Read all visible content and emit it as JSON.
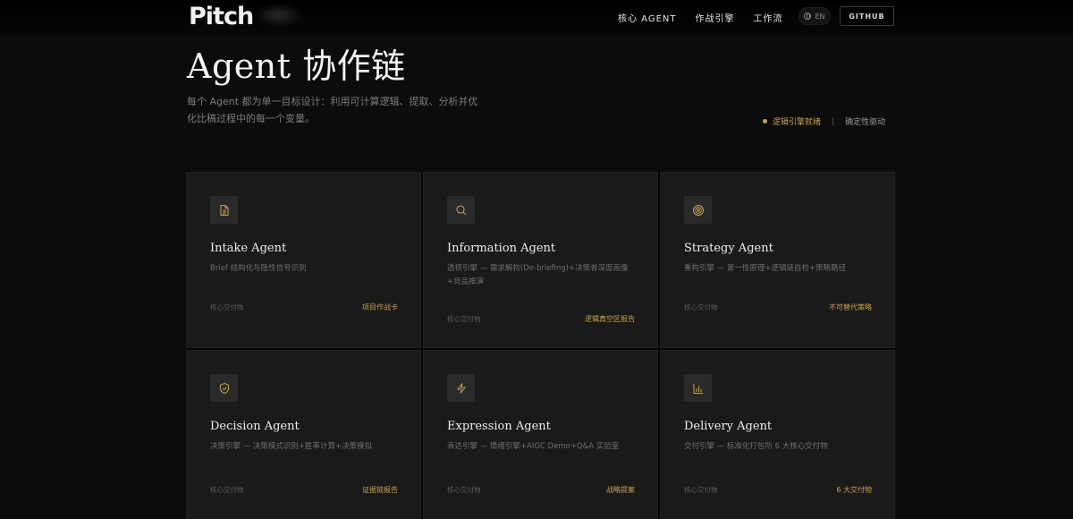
{
  "nav": {
    "logo": "Pitch",
    "links": [
      "核心 AGENT",
      "作战引擎",
      "工作流"
    ],
    "lang": "EN",
    "github": "GITHUB"
  },
  "hero": {
    "title": "Agent 协作链",
    "description": "每个 Agent 都为单一目标设计：利用可计算逻辑、提取、分析并优化比稿过程中的每一个变量。",
    "status_ready": "逻辑引擎就绪",
    "status_sep": "|",
    "status_drive": "确定性驱动"
  },
  "colors": {
    "accent": "#c9a24e",
    "background": "#0c0c0c",
    "card": "#1a1a1a"
  },
  "cards": [
    {
      "icon": "document-icon",
      "title": "Intake Agent",
      "desc": "Brief 结构化与隐性信号识别",
      "foot_label": "核心交付物",
      "foot_value": "项目作战卡"
    },
    {
      "icon": "search-icon",
      "title": "Information Agent",
      "desc": "透视引擎 — 需求解构(De-briefing)+决策者深度画像+竞品推演",
      "foot_label": "核心交付物",
      "foot_value": "逻辑真空区报告"
    },
    {
      "icon": "target-icon",
      "title": "Strategy Agent",
      "desc": "重构引擎 — 第一性原理+逻辑链自检+策略路径",
      "foot_label": "核心交付物",
      "foot_value": "不可替代策略"
    },
    {
      "icon": "shield-check-icon",
      "title": "Decision Agent",
      "desc": "决策引擎 — 决策模式识别+胜率计算+决策模拟",
      "foot_label": "核心交付物",
      "foot_value": "证据链报告"
    },
    {
      "icon": "lightning-icon",
      "title": "Expression Agent",
      "desc": "表达引擎 — 情绪引擎+AIGC Demo+Q&A 实验室",
      "foot_label": "核心交付物",
      "foot_value": "战略提案"
    },
    {
      "icon": "bar-chart-icon",
      "title": "Delivery Agent",
      "desc": "交付引擎 — 标准化打包所 6 大核心交付物",
      "foot_label": "核心交付物",
      "foot_value": "6  大交付物"
    }
  ]
}
